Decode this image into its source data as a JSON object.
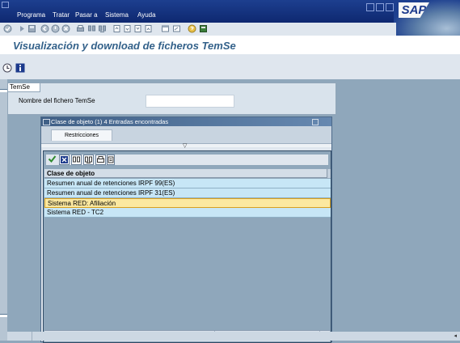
{
  "menu": {
    "items": [
      "Programa",
      "Tratar",
      "Pasar a",
      "Sistema",
      "Ayuda"
    ],
    "mnemonics": [
      "r",
      "T",
      "P",
      "S",
      "A"
    ]
  },
  "brand": {
    "logo_text": "SAP"
  },
  "page_title": "Visualización y download de ficheros TemSe",
  "group": {
    "tab_label": "TemSe",
    "field_label": "Nombre del fichero TemSe",
    "field_value": ""
  },
  "dialog": {
    "title": "Clase de objeto (1)   4 Entradas encontradas",
    "tab_label": "Restricciones",
    "list_header": "Clase de objeto",
    "rows": [
      "Resumen anual de retenciones IRPF 99(ES)",
      "Resumen anual de retenciones IRPF 31(ES)",
      "Sistema RED: Afiliación",
      "Sistema RED - TC2"
    ],
    "selected_index": 2
  },
  "colors": {
    "menubar": "#1d3f8f",
    "title_text": "#33618a",
    "row_bg": "#c7e6f6",
    "row_selected_bg": "#fbe8a0",
    "canvas": "#8fa7bb"
  },
  "icons": {
    "std_toolbar": [
      "checkmark-icon",
      "command-field-icon",
      "save-icon",
      "back-icon",
      "exit-icon",
      "cancel-icon",
      "print-icon",
      "find-icon",
      "find-next-icon",
      "first-page-icon",
      "prev-page-icon",
      "next-page-icon",
      "last-page-icon",
      "new-session-icon",
      "shortcut-icon",
      "help-icon",
      "layout-menu-icon"
    ],
    "app_toolbar": [
      "execute-icon",
      "info-icon"
    ],
    "dialog_toolbar": [
      "copy-checkmark-icon",
      "cancel-icon",
      "find-icon",
      "find-next-icon",
      "print-icon",
      "more-icon"
    ]
  }
}
